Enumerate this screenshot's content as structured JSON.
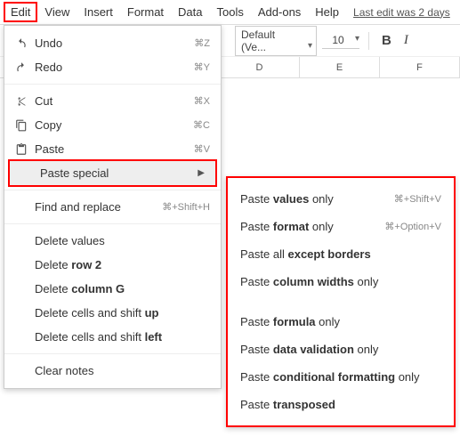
{
  "menubar": {
    "items": [
      "Edit",
      "View",
      "Insert",
      "Format",
      "Data",
      "Tools",
      "Add-ons",
      "Help"
    ],
    "last_edit": "Last edit was 2 days"
  },
  "toolbar": {
    "font": "Default (Ve...",
    "size": "10"
  },
  "columns": [
    "D",
    "E",
    "F"
  ],
  "edit_menu": {
    "undo": {
      "label": "Undo",
      "shortcut": "⌘Z"
    },
    "redo": {
      "label": "Redo",
      "shortcut": "⌘Y"
    },
    "cut": {
      "label": "Cut",
      "shortcut": "⌘X"
    },
    "copy": {
      "label": "Copy",
      "shortcut": "⌘C"
    },
    "paste": {
      "label": "Paste",
      "shortcut": "⌘V"
    },
    "paste_special": {
      "label": "Paste special"
    },
    "find_replace": {
      "label": "Find and replace",
      "shortcut": "⌘+Shift+H"
    },
    "delete_values": {
      "label": "Delete values"
    },
    "delete_row": {
      "label_pre": "Delete ",
      "label_bold": "row 2"
    },
    "delete_col": {
      "label_pre": "Delete ",
      "label_bold": "column G"
    },
    "delete_shift_up": {
      "label_pre": "Delete cells and shift ",
      "label_bold": "up"
    },
    "delete_shift_left": {
      "label_pre": "Delete cells and shift ",
      "label_bold": "left"
    },
    "clear_notes": {
      "label": "Clear notes"
    }
  },
  "paste_special_menu": {
    "values": {
      "pre": "Paste ",
      "bold": "values",
      "post": " only",
      "shortcut": "⌘+Shift+V"
    },
    "format": {
      "pre": "Paste ",
      "bold": "format",
      "post": " only",
      "shortcut": "⌘+Option+V"
    },
    "except_borders": {
      "pre": "Paste all ",
      "bold": "except borders",
      "post": ""
    },
    "col_widths": {
      "pre": "Paste ",
      "bold": "column widths",
      "post": " only"
    },
    "formula": {
      "pre": "Paste ",
      "bold": "formula",
      "post": " only"
    },
    "data_validation": {
      "pre": "Paste ",
      "bold": "data validation",
      "post": " only"
    },
    "cond_format": {
      "pre": "Paste ",
      "bold": "conditional formatting",
      "post": " only"
    },
    "transposed": {
      "pre": "Paste ",
      "bold": "transposed",
      "post": ""
    }
  }
}
